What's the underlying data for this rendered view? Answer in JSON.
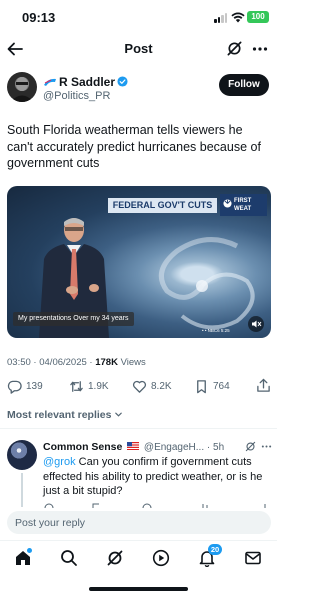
{
  "status_bar": {
    "time": "09:13",
    "battery": "100"
  },
  "header": {
    "title": "Post"
  },
  "post": {
    "author_name": "R Saddler",
    "author_handle": "@Politics_PR",
    "follow_label": "Follow",
    "text": "South Florida weatherman tells viewers he can't accurately predict hurricanes because of government cuts",
    "media": {
      "banner": "FEDERAL GOV'T CUTS",
      "station_logo_line1": "FIRST",
      "station_logo_line2": "WEAT",
      "caption": "My presentations Over my 34 years",
      "watermark": "• • NBC6",
      "clock": "5:25"
    },
    "time": "03:50",
    "separator": "·",
    "date": "04/06/2025",
    "views_count": "178K",
    "views_label": "Views",
    "stats": {
      "replies": "139",
      "reposts": "1.9K",
      "likes": "8.2K",
      "bookmarks": "764"
    }
  },
  "sort": {
    "label": "Most relevant replies"
  },
  "reply": {
    "name": "Common Sense",
    "handle": "@EngageH...",
    "separator": "·",
    "time": "5h",
    "mention": "@grok",
    "text": " Can you confirm if government cuts effected his ability to predict weather, or is he just a bit stupid?"
  },
  "composer": {
    "placeholder": "Post your reply"
  },
  "tabbar": {
    "notifications_badge": "20"
  },
  "colors": {
    "accent": "#1d9bf0",
    "text": "#0f1419",
    "muted": "#536471",
    "battery": "#34c759"
  }
}
